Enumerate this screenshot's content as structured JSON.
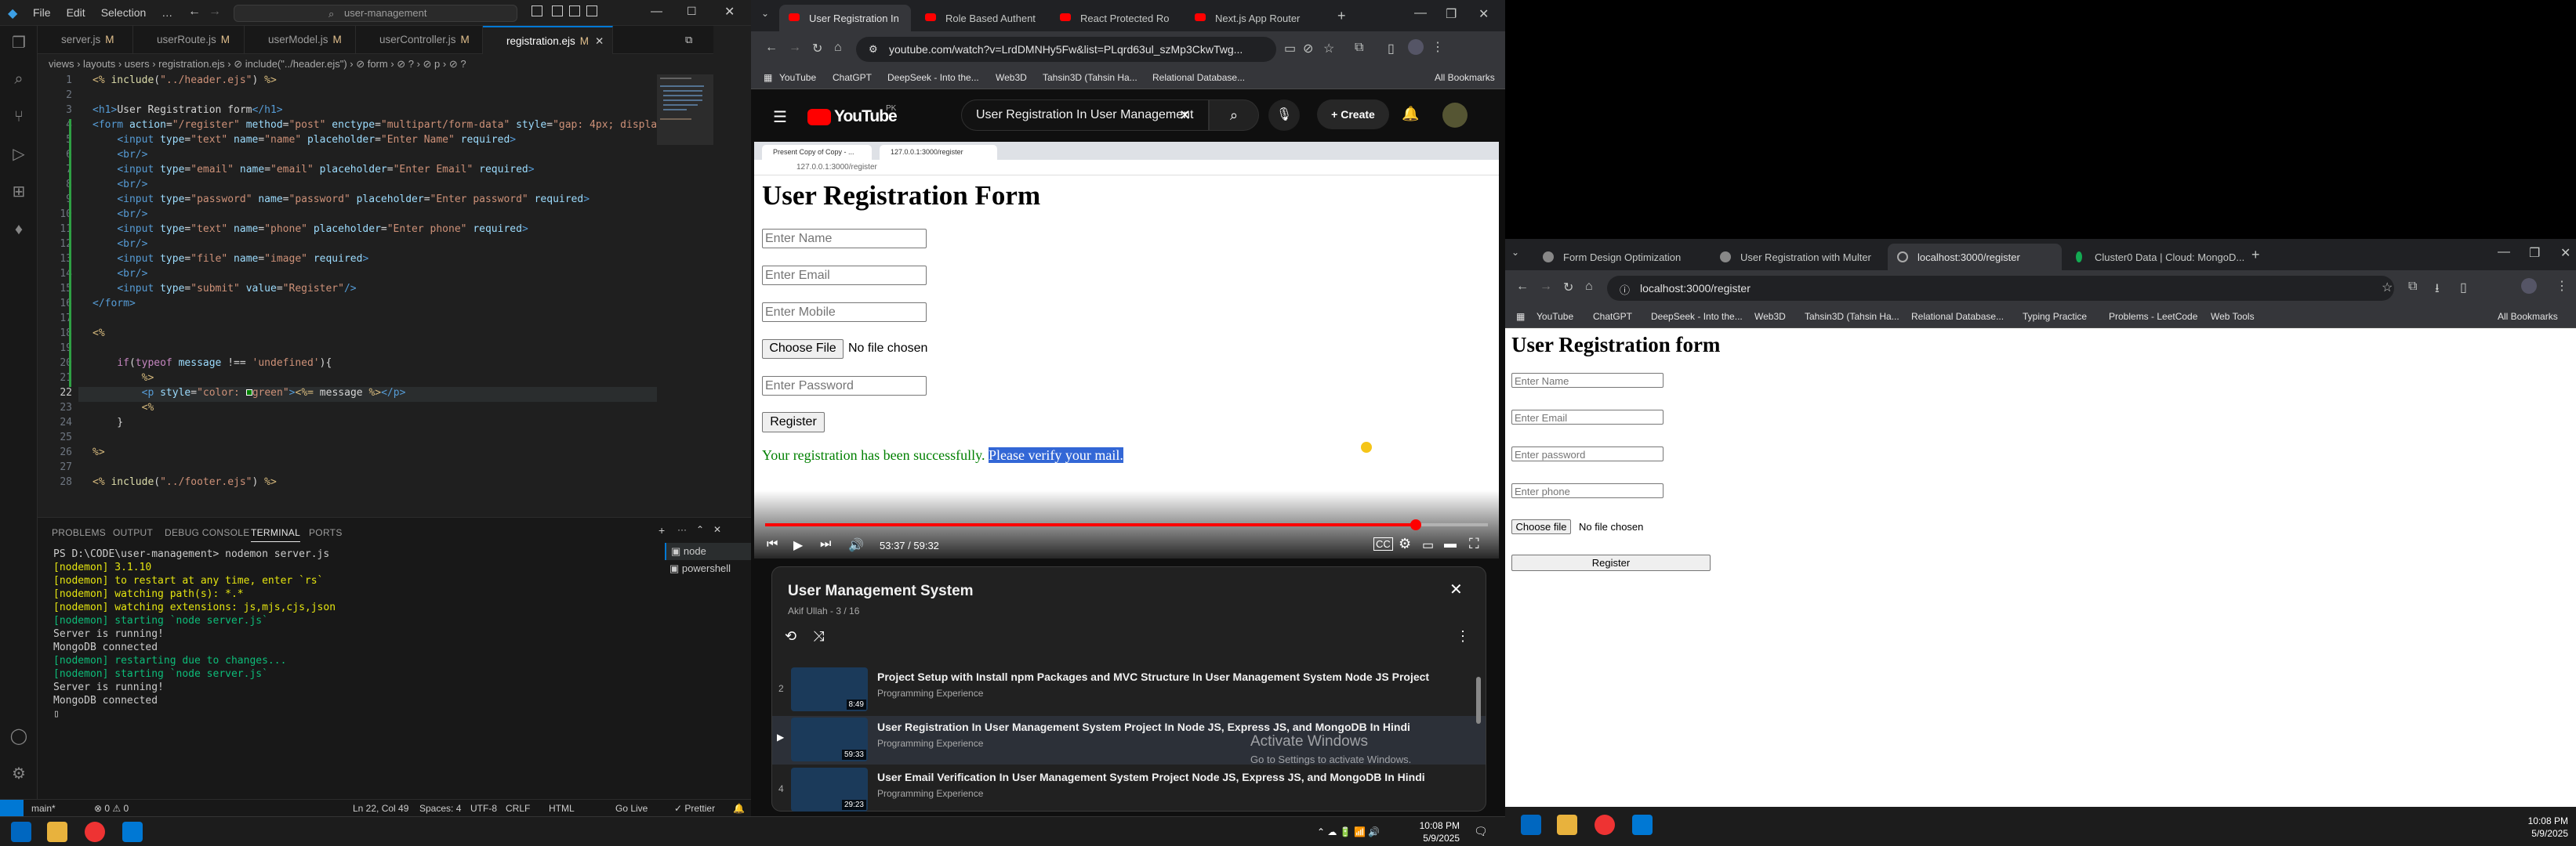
{
  "vscode": {
    "menu": [
      "File",
      "Edit",
      "Selection",
      "…"
    ],
    "search": "user-management",
    "tabs": [
      {
        "label": "server.js",
        "mark": "M"
      },
      {
        "label": "userRoute.js",
        "mark": "M"
      },
      {
        "label": "userModel.js",
        "mark": "M"
      },
      {
        "label": "userController.js",
        "mark": "M"
      },
      {
        "label": "registration.ejs",
        "mark": "M"
      }
    ],
    "breadcrumb": "views › layouts › users › registration.ejs › ⊘ include(\"../header.ejs\") › ⊘ form › ⊘ ? › ⊘ p › ⊘ ?",
    "lines": [
      "1",
      "2",
      "3",
      "4",
      "5",
      "6",
      "7",
      "8",
      "9",
      "10",
      "11",
      "12",
      "13",
      "14",
      "15",
      "16",
      "17",
      "18",
      "19",
      "20",
      "21",
      "22",
      "23",
      "24",
      "25",
      "26",
      "27",
      "28"
    ],
    "panel_tabs": [
      "PROBLEMS",
      "OUTPUT",
      "DEBUG CONSOLE",
      "TERMINAL",
      "PORTS"
    ],
    "terminal": [
      "PS D:\\CODE\\user-management> nodemon server.js",
      "[nodemon] 3.1.10",
      "[nodemon] to restart at any time, enter `rs`",
      "[nodemon] watching path(s): *.*",
      "[nodemon] watching extensions: js,mjs,cjs,json",
      "[nodemon] starting `node server.js`",
      "Server is running!",
      "MongoDB connected",
      "[nodemon] restarting due to changes...",
      "[nodemon] starting `node server.js`",
      "Server is running!",
      "MongoDB connected"
    ],
    "terminal_list": [
      "node",
      "powershell"
    ],
    "status": {
      "branch": "main*",
      "errors": "⊗ 0 ⚠ 0",
      "position": "Ln 22, Col 49",
      "spaces": "Spaces: 4",
      "encoding": "UTF-8",
      "eol": "CRLF",
      "lang": "HTML",
      "golive": "Go Live",
      "prettier": "✓ Prettier"
    }
  },
  "youtube": {
    "tabs": [
      "User Registration In",
      "Role Based Authent",
      "React Protected Ro",
      "Next.js App Router"
    ],
    "url": "youtube.com/watch?v=LrdDMNHy5Fw&list=PLqrd63ul_szMp3CkwTwg...",
    "bookmarks": [
      "YouTube",
      "ChatGPT",
      "DeepSeek - Into the...",
      "Web3D",
      "Tahsin3D (Tahsin Ha...",
      "Relational Database...",
      "All Bookmarks"
    ],
    "logo": "YouTube",
    "region": "PK",
    "search": "User Registration In User Management",
    "create": "+ Create",
    "video": {
      "inner_tabs": [
        "Present Copy of Copy - ...",
        "127.0.0.1:3000/register"
      ],
      "inner_url": "127.0.0.1:3000/register",
      "heading": "User Registration Form",
      "placeholders": [
        "Enter Name",
        "Enter Email",
        "Enter Mobile",
        "Enter Password"
      ],
      "file_button": "Choose File",
      "file_status": "No file chosen",
      "submit": "Register",
      "message": "Your registration has been successfully.",
      "message_highlight": "Please verify your mail.",
      "time": "53:37 / 59:32",
      "progress": 0.9
    },
    "playlist": {
      "title": "User Management System",
      "meta": "Akif Ullah - 3 / 16",
      "items": [
        {
          "index": "2",
          "duration": "8:49",
          "title": "Project Setup with Install npm Packages and MVC Structure In User Management System Node JS Project",
          "channel": "Programming Experience"
        },
        {
          "index": "▶",
          "duration": "59:33",
          "title": "User Registration In User Management System Project In Node JS, Express JS, and MongoDB In Hindi",
          "channel": "Programming Experience"
        },
        {
          "index": "4",
          "duration": "29:23",
          "title": "User Email Verification In User Management System Project Node JS, Express JS, and MongoDB In Hindi",
          "channel": "Programming Experience"
        }
      ],
      "watermark1": "Activate Windows",
      "watermark2": "Go to Settings to activate Windows."
    }
  },
  "localhost": {
    "tabs": [
      "Form Design Optimization",
      "User Registration with Multer",
      "localhost:3000/register",
      "Cluster0 Data | Cloud: MongoD..."
    ],
    "url": "localhost:3000/register",
    "bookmarks": [
      "YouTube",
      "ChatGPT",
      "DeepSeek - Into the...",
      "Web3D",
      "Tahsin3D (Tahsin Ha...",
      "Relational Database...",
      "Typing Practice",
      "Problems - LeetCode",
      "Web Tools",
      "All Bookmarks"
    ],
    "heading": "User Registration form",
    "placeholders": [
      "Enter Name",
      "Enter Email",
      "Enter password",
      "Enter phone"
    ],
    "file_button": "Choose file",
    "file_status": "No file chosen",
    "submit": "Register"
  },
  "taskbar": {
    "time1": "10:08 PM",
    "date1": "5/9/2025",
    "time2": "10:08 PM",
    "date2": "5/9/2025"
  }
}
